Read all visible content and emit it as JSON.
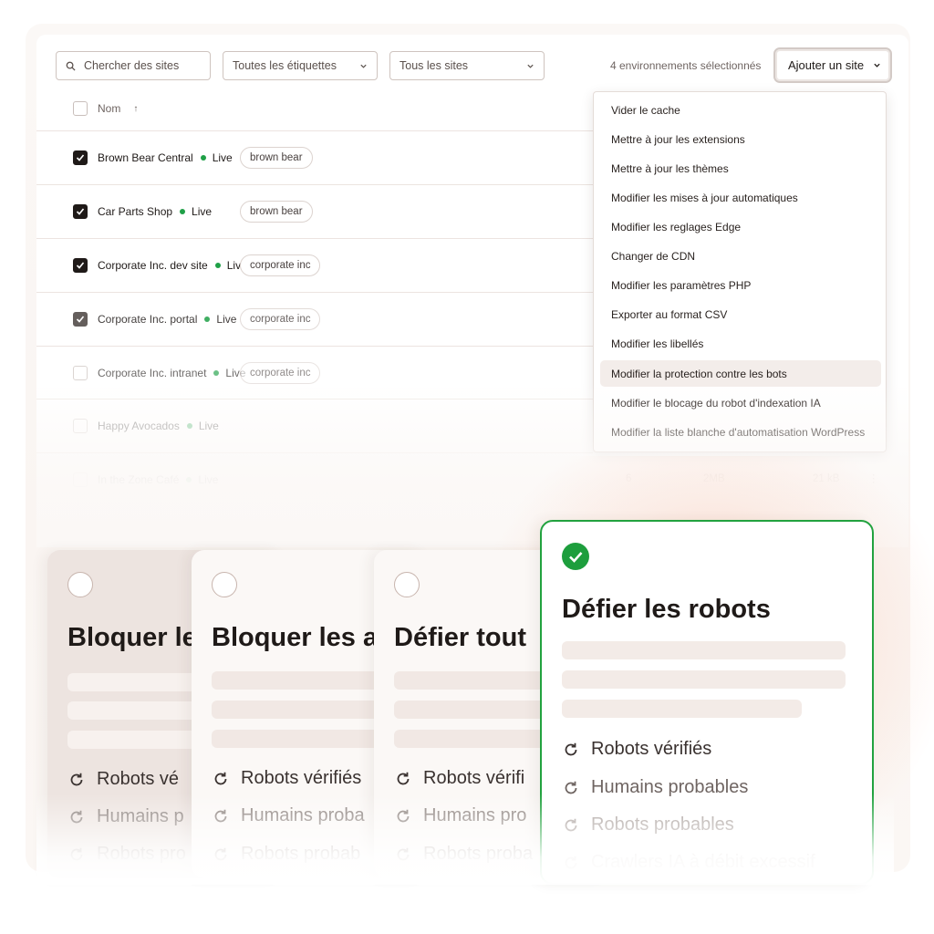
{
  "toolbar": {
    "search_placeholder": "Chercher des sites",
    "tags_filter": "Toutes les étiquettes",
    "sites_filter": "Tous les sites",
    "selection_info": "4 environnements sélectionnés",
    "add_site_label": "Ajouter un site"
  },
  "table": {
    "name_header": "Nom",
    "sort_arrow": "↑",
    "rows": [
      {
        "name": "Brown Bear Central",
        "status": "Live",
        "tag": "brown bear",
        "checked": true
      },
      {
        "name": "Car Parts Shop",
        "status": "Live",
        "tag": "brown bear",
        "checked": true
      },
      {
        "name": "Corporate Inc. dev site",
        "status": "Live",
        "tag": "corporate inc",
        "checked": true
      },
      {
        "name": "Corporate Inc. portal",
        "status": "Live",
        "tag": "corporate inc",
        "checked": true
      },
      {
        "name": "Corporate Inc. intranet",
        "status": "Live",
        "tag": "corporate inc",
        "checked": false
      },
      {
        "name": "Happy Avocados",
        "status": "Live",
        "tag": "",
        "checked": false
      },
      {
        "name": "In the Zone Café",
        "status": "Live",
        "tag": "",
        "checked": false,
        "count": "6",
        "disk": "2MB",
        "bandwidth": "21 kB"
      }
    ],
    "status_color": "#1fa047"
  },
  "menu": {
    "items": [
      "Vider le cache",
      "Mettre à jour les extensions",
      "Mettre à jour les thèmes",
      "Modifier les mises à jour automatiques",
      "Modifier les reglages Edge",
      "Changer de CDN",
      "Modifier les paramètres PHP",
      "Exporter au format CSV",
      "Modifier les libellés",
      "Modifier la protection contre les bots",
      "Modifier le blocage du robot d'indexation IA",
      "Modifier la liste blanche d'automatisation WordPress"
    ],
    "highlighted_index": 9
  },
  "cards": [
    {
      "title": "Bloquer le",
      "features": [
        "Robots vé",
        "Humains p",
        "Robots pro"
      ],
      "selected": false
    },
    {
      "title": "Bloquer les a",
      "features": [
        "Robots vérifiés",
        "Humains proba",
        "Robots probab"
      ],
      "selected": false
    },
    {
      "title": "Défier tout",
      "features": [
        "Robots vérifi",
        "Humains pro",
        "Robots proba"
      ],
      "selected": false
    },
    {
      "title": "Défier les robots",
      "features": [
        "Robots vérifiés",
        "Humains probables",
        "Robots probables",
        "Crawlers IA à débit excessif"
      ],
      "selected": true
    }
  ],
  "colors": {
    "accent_green": "#1d9e3d",
    "card_border": "#22a23f",
    "glow": "#f8aa8c"
  }
}
